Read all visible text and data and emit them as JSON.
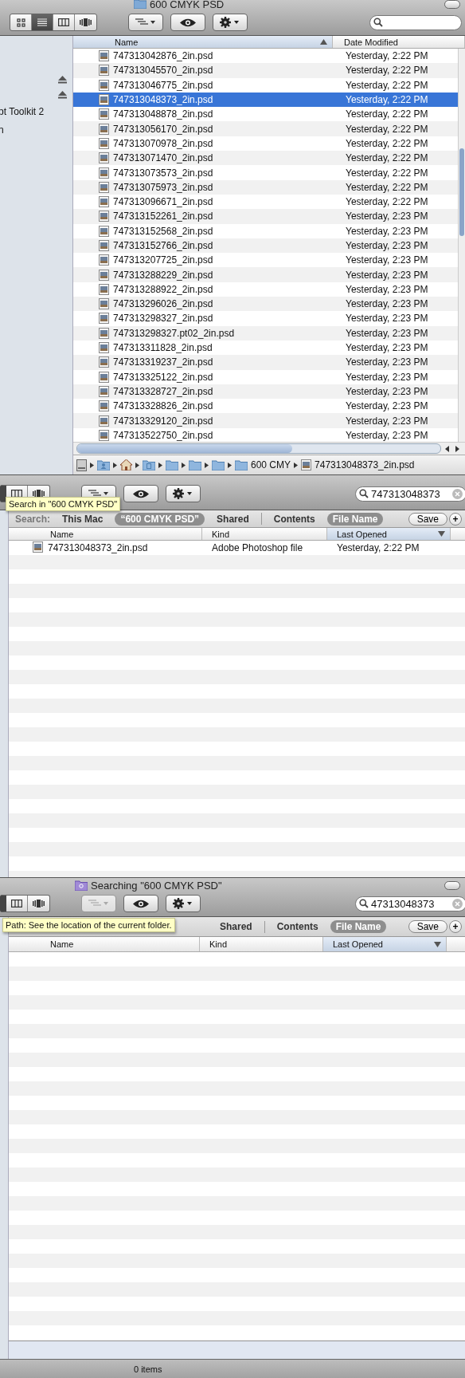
{
  "folder_window": {
    "title": "600 CMYK PSD",
    "view_modes": [
      {
        "kind": "icon",
        "selected": false
      },
      {
        "kind": "list",
        "selected": true
      },
      {
        "kind": "column",
        "selected": false
      },
      {
        "kind": "coverflow",
        "selected": false
      }
    ],
    "arrange_disabled": false,
    "sidebar": [
      {
        "kind": "eject"
      },
      {
        "kind": "eject"
      },
      {
        "kind": "text",
        "label": "pt Toolkit 2"
      },
      {
        "kind": "text",
        "label": "n"
      }
    ],
    "columns": [
      {
        "label": "Name",
        "sorted": true,
        "descending": false
      },
      {
        "label": "Date Modified",
        "sorted": false
      }
    ],
    "rows": [
      {
        "name": "747313042876_2in.psd",
        "date": "Yesterday, 2:22 PM",
        "selected": false
      },
      {
        "name": "747313045570_2in.psd",
        "date": "Yesterday, 2:22 PM",
        "selected": false
      },
      {
        "name": "747313046775_2in.psd",
        "date": "Yesterday, 2:22 PM",
        "selected": false
      },
      {
        "name": "747313048373_2in.psd",
        "date": "Yesterday, 2:22 PM",
        "selected": true
      },
      {
        "name": "747313048878_2in.psd",
        "date": "Yesterday, 2:22 PM",
        "selected": false
      },
      {
        "name": "747313056170_2in.psd",
        "date": "Yesterday, 2:22 PM",
        "selected": false
      },
      {
        "name": "747313070978_2in.psd",
        "date": "Yesterday, 2:22 PM",
        "selected": false
      },
      {
        "name": "747313071470_2in.psd",
        "date": "Yesterday, 2:22 PM",
        "selected": false
      },
      {
        "name": "747313073573_2in.psd",
        "date": "Yesterday, 2:22 PM",
        "selected": false
      },
      {
        "name": "747313075973_2in.psd",
        "date": "Yesterday, 2:22 PM",
        "selected": false
      },
      {
        "name": "747313096671_2in.psd",
        "date": "Yesterday, 2:22 PM",
        "selected": false
      },
      {
        "name": "747313152261_2in.psd",
        "date": "Yesterday, 2:23 PM",
        "selected": false
      },
      {
        "name": "747313152568_2in.psd",
        "date": "Yesterday, 2:23 PM",
        "selected": false
      },
      {
        "name": "747313152766_2in.psd",
        "date": "Yesterday, 2:23 PM",
        "selected": false
      },
      {
        "name": "747313207725_2in.psd",
        "date": "Yesterday, 2:23 PM",
        "selected": false
      },
      {
        "name": "747313288229_2in.psd",
        "date": "Yesterday, 2:23 PM",
        "selected": false
      },
      {
        "name": "747313288922_2in.psd",
        "date": "Yesterday, 2:23 PM",
        "selected": false
      },
      {
        "name": "747313296026_2in.psd",
        "date": "Yesterday, 2:23 PM",
        "selected": false
      },
      {
        "name": "747313298327_2in.psd",
        "date": "Yesterday, 2:23 PM",
        "selected": false
      },
      {
        "name": "747313298327.pt02_2in.psd",
        "date": "Yesterday, 2:23 PM",
        "selected": false
      },
      {
        "name": "747313311828_2in.psd",
        "date": "Yesterday, 2:23 PM",
        "selected": false
      },
      {
        "name": "747313319237_2in.psd",
        "date": "Yesterday, 2:23 PM",
        "selected": false
      },
      {
        "name": "747313325122_2in.psd",
        "date": "Yesterday, 2:23 PM",
        "selected": false
      },
      {
        "name": "747313328727_2in.psd",
        "date": "Yesterday, 2:23 PM",
        "selected": false
      },
      {
        "name": "747313328826_2in.psd",
        "date": "Yesterday, 2:23 PM",
        "selected": false
      },
      {
        "name": "747313329120_2in.psd",
        "date": "Yesterday, 2:23 PM",
        "selected": false
      },
      {
        "name": "747313522750_2in.psd",
        "date": "Yesterday, 2:23 PM",
        "selected": false
      }
    ],
    "path": [
      {
        "kind": "disk"
      },
      {
        "kind": "user"
      },
      {
        "kind": "home"
      },
      {
        "kind": "documents"
      },
      {
        "kind": "folder"
      },
      {
        "kind": "folder"
      },
      {
        "kind": "folder"
      },
      {
        "kind": "folder",
        "label": "600 CMY"
      },
      {
        "kind": "file",
        "label": "747313048373_2in.psd"
      }
    ]
  },
  "search_window": {
    "view_modes": [
      {
        "kind": "column",
        "selected": false
      },
      {
        "kind": "coverflow",
        "selected": false
      }
    ],
    "arrange_disabled": false,
    "search": {
      "value": "747313048373"
    },
    "tooltip": "Search in \"600 CMYK PSD\"",
    "scope": [
      {
        "kind": "label",
        "label": "Search:"
      },
      {
        "kind": "option",
        "label": "This Mac",
        "selected": false
      },
      {
        "kind": "option",
        "label": "“600 CMYK PSD”",
        "selected": true
      },
      {
        "kind": "option",
        "label": "Shared",
        "selected": false
      },
      {
        "kind": "divider"
      },
      {
        "kind": "option",
        "label": "Contents",
        "selected": false
      },
      {
        "kind": "option",
        "label": "File Name",
        "selected": true
      },
      {
        "kind": "save",
        "label": "Save"
      },
      {
        "kind": "add",
        "label": "+"
      }
    ],
    "columns": [
      {
        "label": "Name",
        "sorted": false
      },
      {
        "label": "Kind",
        "sorted": false
      },
      {
        "label": "Last Opened",
        "sorted": true,
        "descending": true
      }
    ],
    "rows": [
      {
        "name": "747313048373_2in.psd",
        "kind": "Adobe Photoshop file",
        "date": "Yesterday, 2:22 PM",
        "selected": false
      }
    ]
  },
  "search_window_2": {
    "title": "Searching \"600 CMYK PSD\"",
    "view_modes": [
      {
        "kind": "column",
        "selected": false
      },
      {
        "kind": "coverflow",
        "selected": false
      }
    ],
    "arrange_disabled": true,
    "search": {
      "value": "47313048373"
    },
    "tooltip": "Path: See the location of the current folder.",
    "scope": [
      {
        "kind": "option",
        "label": "Shared",
        "selected": false
      },
      {
        "kind": "divider"
      },
      {
        "kind": "option",
        "label": "Contents",
        "selected": false
      },
      {
        "kind": "option",
        "label": "File Name",
        "selected": true
      },
      {
        "kind": "save",
        "label": "Save"
      },
      {
        "kind": "add",
        "label": "+"
      }
    ],
    "columns": [
      {
        "label": "Name",
        "sorted": false
      },
      {
        "label": "Kind",
        "sorted": false
      },
      {
        "label": "Last Opened",
        "sorted": true,
        "descending": true
      }
    ],
    "status": "0 items"
  }
}
